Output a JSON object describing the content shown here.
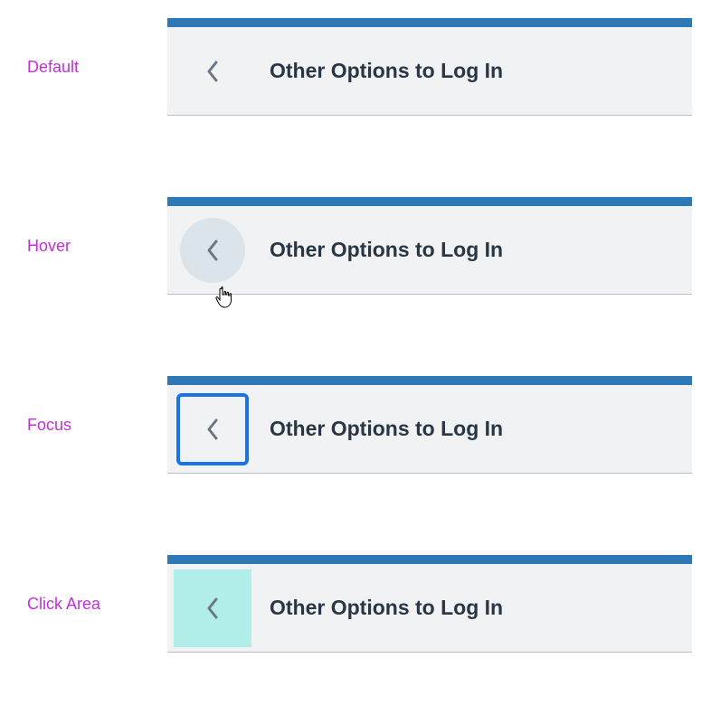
{
  "states": {
    "default": {
      "label": "Default",
      "title": "Other Options to Log In"
    },
    "hover": {
      "label": "Hover",
      "title": "Other Options to Log In"
    },
    "focus": {
      "label": "Focus",
      "title": "Other Options to Log In"
    },
    "clickarea": {
      "label": "Click Area",
      "title": "Other Options to Log In"
    }
  },
  "icons": {
    "back": "chevron-left-icon",
    "cursor": "pointer-cursor-icon"
  },
  "colors": {
    "label": "#c030d8",
    "panel_bg": "#f1f2f3",
    "panel_top_border": "#2f78b6",
    "panel_bottom_border": "#b7c0c9",
    "title_text": "#293646",
    "chevron": "#6b7683",
    "hover_bg": "#dbe4eb",
    "focus_ring": "#1a73e8",
    "click_area": "#b1ede9"
  }
}
